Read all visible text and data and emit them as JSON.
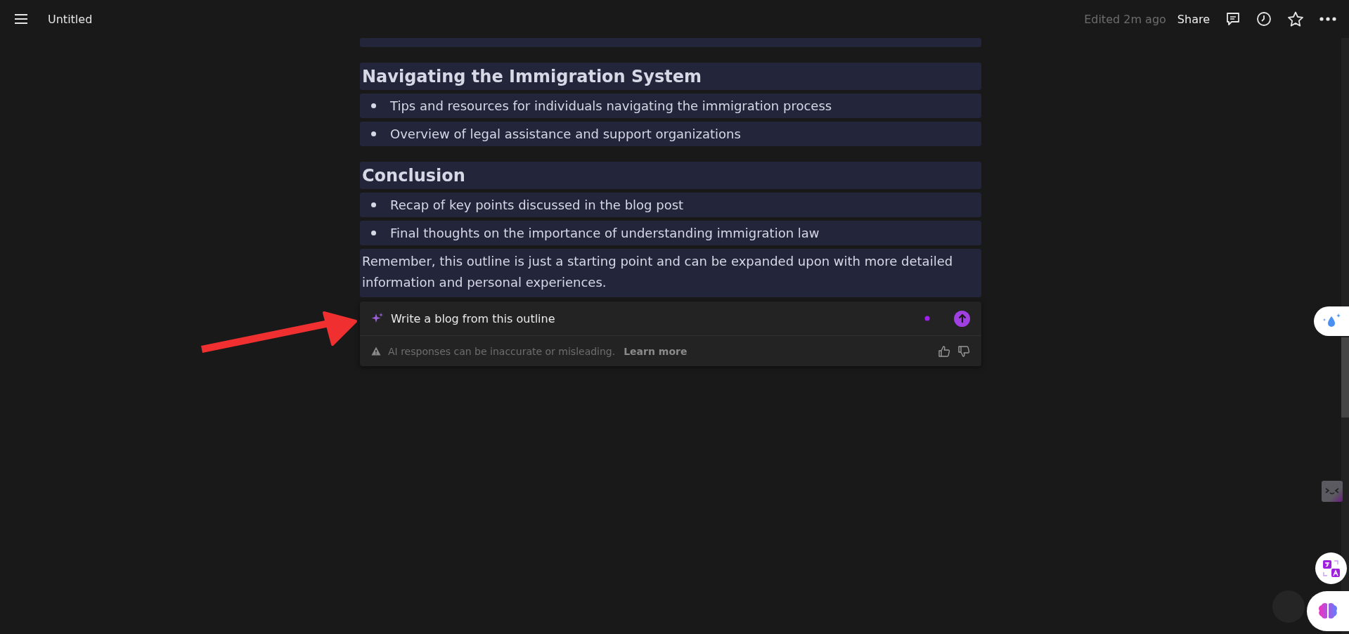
{
  "topbar": {
    "title": "Untitled",
    "edited": "Edited 2m ago",
    "share": "Share"
  },
  "blocks": [
    {
      "kind": "heading",
      "text": "Navigating the Immigration System"
    },
    {
      "kind": "bullet",
      "text": "Tips and resources for individuals navigating the immigration process"
    },
    {
      "kind": "bullet",
      "text": "Overview of legal assistance and support organizations"
    },
    {
      "kind": "heading",
      "text": "Conclusion"
    },
    {
      "kind": "bullet",
      "text": "Recap of key points discussed in the blog post"
    },
    {
      "kind": "bullet",
      "text": "Final thoughts on the importance of understanding immigration law"
    },
    {
      "kind": "paragraph",
      "text": "Remember, this outline is just a starting point and can be expanded upon with more detailed information and personal experiences."
    }
  ],
  "prompt": {
    "value": "Write a blog from this outline",
    "disclaimer": "AI responses can be inaccurate or misleading.",
    "learn_more": "Learn more"
  }
}
